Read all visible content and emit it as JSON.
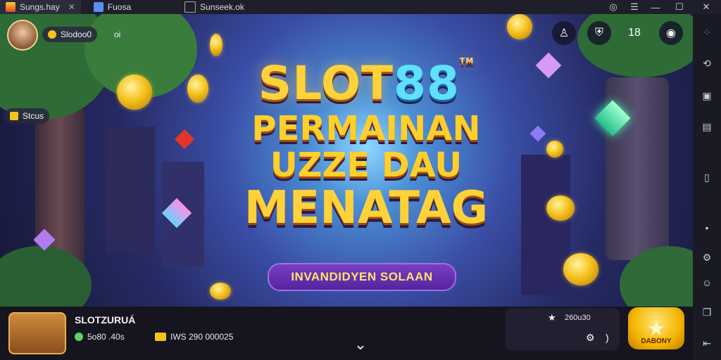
{
  "window": {
    "tabs": [
      {
        "label": "Sungs.hay",
        "active": true
      },
      {
        "label": "Fuosa",
        "active": false
      },
      {
        "label": "Sunseek.ok",
        "active": false
      }
    ],
    "tab_close": "✕",
    "controls": {
      "status": "◎",
      "menu": "☰",
      "minimize": "—",
      "maximize": "☐",
      "close": "✕"
    }
  },
  "sidebar": {
    "icons": [
      "grid-icon",
      "link-icon",
      "window-icon",
      "document-icon",
      "mobile-icon",
      "dot-icon",
      "gear-icon",
      "emoji-icon",
      "copy-icon",
      "back-icon"
    ],
    "glyphs": [
      "⁘",
      "⟲",
      "▣",
      "▤",
      "▯",
      "•",
      "⚙",
      "☺",
      "❐",
      "⇤"
    ]
  },
  "header": {
    "balance": "Slodoo0",
    "balance_suffix": "oi",
    "bonus": "Stcus",
    "top_icons": [
      {
        "name": "person-icon",
        "glyph": "♙"
      },
      {
        "name": "shield-icon",
        "glyph": "⛨"
      },
      {
        "name": "rank-icon",
        "glyph": "18"
      },
      {
        "name": "chat-icon",
        "glyph": "◉"
      }
    ]
  },
  "banner": {
    "title_word": "SLOT",
    "title_number": "88",
    "trademark": "TM",
    "line1": "PERMAINAN",
    "line2": "UZZE DAU",
    "line3": "MENATAG",
    "ribbon": "INVANDIDYEN SOLAAN"
  },
  "bottom": {
    "game_name": "SLOTZURUÁ",
    "stats": [
      {
        "label": "5o80 .40s"
      },
      {
        "label": "IWS 290 000025"
      }
    ],
    "panel_value": "260u30",
    "panel_suffix": ")",
    "big_button": "DABONY",
    "chevron": "⌄"
  },
  "colors": {
    "accent_gold": "#ffd23a",
    "ribbon_purple": "#6a33b8",
    "sidebar_bg": "#191a24"
  }
}
